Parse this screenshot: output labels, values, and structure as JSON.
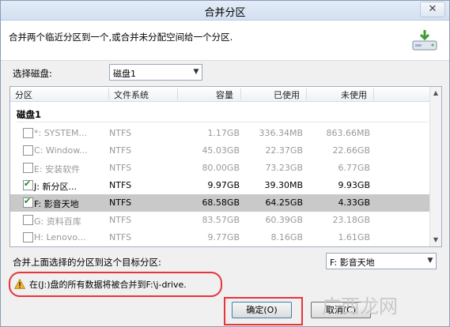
{
  "window": {
    "title": "合并分区",
    "close_label": "✕"
  },
  "header": {
    "description": "合并两个临近分区到一个,或合并未分配空间给一个分区.",
    "icon": "disk-merge-icon"
  },
  "disk_select": {
    "label": "选择磁盘:",
    "value": "磁盘1"
  },
  "table": {
    "columns": [
      "分区",
      "文件系统",
      "容量",
      "已使用",
      "未使用"
    ],
    "group_label": "磁盘1",
    "rows": [
      {
        "name": "*: SYSTEM...",
        "fs": "NTFS",
        "capacity": "1.17GB",
        "used": "336.34MB",
        "free": "863.66MB",
        "checked": false,
        "enabled": false,
        "selected": false
      },
      {
        "name": "C: Window...",
        "fs": "NTFS",
        "capacity": "45.03GB",
        "used": "22.37GB",
        "free": "22.66GB",
        "checked": false,
        "enabled": false,
        "selected": false
      },
      {
        "name": "E: 安装软件",
        "fs": "NTFS",
        "capacity": "80.00GB",
        "used": "73.23GB",
        "free": "6.77GB",
        "checked": false,
        "enabled": false,
        "selected": false
      },
      {
        "name": "J: 新分区...",
        "fs": "NTFS",
        "capacity": "9.97GB",
        "used": "39.30MB",
        "free": "9.93GB",
        "checked": true,
        "enabled": true,
        "selected": false
      },
      {
        "name": "F: 影音天地",
        "fs": "NTFS",
        "capacity": "68.58GB",
        "used": "64.25GB",
        "free": "4.33GB",
        "checked": true,
        "enabled": true,
        "selected": true
      },
      {
        "name": "G: 资料百库",
        "fs": "NTFS",
        "capacity": "83.57GB",
        "used": "60.39GB",
        "free": "23.18GB",
        "checked": false,
        "enabled": false,
        "selected": false
      },
      {
        "name": "H: Lenovo...",
        "fs": "NTFS",
        "capacity": "9.77GB",
        "used": "8.16GB",
        "free": "1.61GB",
        "checked": false,
        "enabled": false,
        "selected": false
      }
    ]
  },
  "target": {
    "label": "合并上面选择的分区到这个目标分区:",
    "value": "F: 影音天地"
  },
  "warning": {
    "text": "在(J:)盘的所有数据将被合并到F:\\j-drive."
  },
  "buttons": {
    "ok": "确定(O)",
    "cancel": "取消(C)"
  },
  "watermark": "广西龙网",
  "colors": {
    "highlight_border": "#e8343a",
    "selected_row": "#c9c9c9",
    "check": "#1a8a1a"
  }
}
